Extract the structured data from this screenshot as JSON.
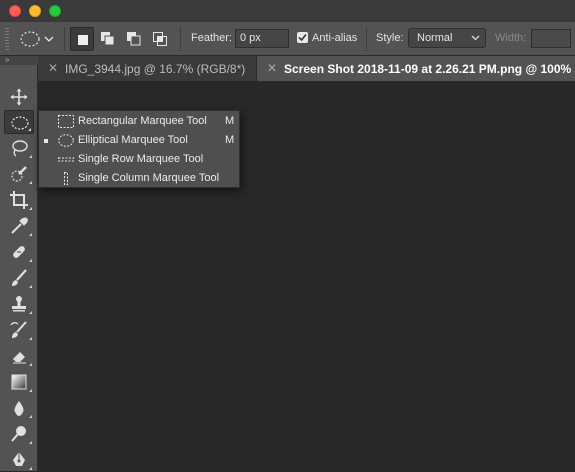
{
  "window": {
    "traffic_lights": [
      {
        "name": "close",
        "color": "#fd5f57"
      },
      {
        "name": "minimize",
        "color": "#febc2e"
      },
      {
        "name": "maximize",
        "color": "#28c840"
      }
    ]
  },
  "options_bar": {
    "feather_label": "Feather:",
    "feather_value": "0 px",
    "antialias_label": "Anti-alias",
    "antialias_checked": true,
    "style_label": "Style:",
    "style_value": "Normal",
    "width_label": "Width:",
    "width_value": ""
  },
  "tabs": [
    {
      "label": "IMG_3944.jpg @ 16.7% (RGB/8*)",
      "active": false
    },
    {
      "label": "Screen Shot 2018-11-09 at 2.26.21 PM.png @ 100%",
      "active": true
    }
  ],
  "toolbar": {
    "expand_glyph": "»",
    "tools": [
      {
        "name": "move-tool-icon",
        "active": false
      },
      {
        "name": "elliptical-marquee-tool-icon",
        "active": true
      },
      {
        "name": "lasso-tool-icon",
        "active": false
      },
      {
        "name": "quick-selection-tool-icon",
        "active": false
      },
      {
        "name": "crop-tool-icon",
        "active": false
      },
      {
        "name": "eyedropper-tool-icon",
        "active": false
      },
      {
        "name": "healing-brush-tool-icon",
        "active": false
      },
      {
        "name": "brush-tool-icon",
        "active": false
      },
      {
        "name": "clone-stamp-tool-icon",
        "active": false
      },
      {
        "name": "history-brush-tool-icon",
        "active": false
      },
      {
        "name": "eraser-tool-icon",
        "active": false
      },
      {
        "name": "gradient-tool-icon",
        "active": false
      },
      {
        "name": "blur-tool-icon",
        "active": false
      },
      {
        "name": "dodge-tool-icon",
        "active": false
      },
      {
        "name": "pen-tool-icon",
        "active": false
      }
    ]
  },
  "flyout": {
    "items": [
      {
        "label": "Rectangular Marquee Tool",
        "shortcut": "M",
        "selected": false
      },
      {
        "label": "Elliptical Marquee Tool",
        "shortcut": "M",
        "selected": true
      },
      {
        "label": "Single Row Marquee Tool",
        "shortcut": "",
        "selected": false
      },
      {
        "label": "Single Column Marquee Tool",
        "shortcut": "",
        "selected": false
      }
    ]
  },
  "colors": {
    "panel": "#535353",
    "canvas": "#282828",
    "accent_text": "#ffffff"
  }
}
